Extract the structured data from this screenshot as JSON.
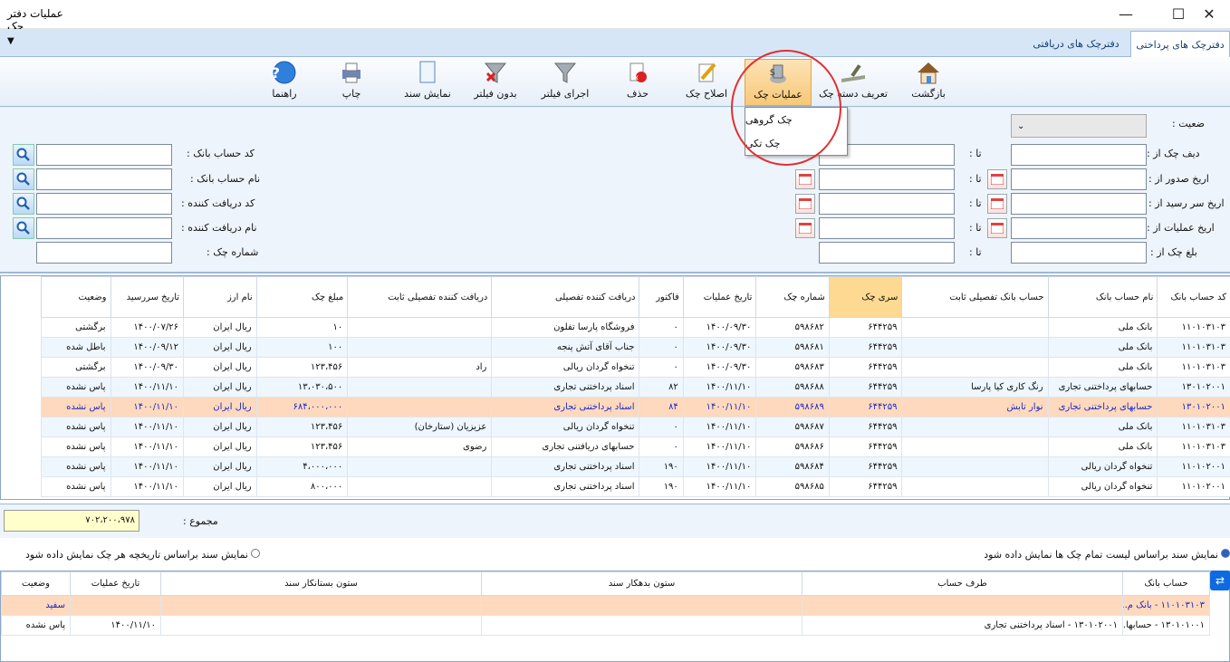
{
  "window": {
    "title": "عملیات دفتر چک",
    "minimize": "—",
    "maximize": "☐",
    "close": "✕"
  },
  "tabs": [
    {
      "label": "دفترچک های پرداختی"
    },
    {
      "label": "دفترچک های دریافتی"
    }
  ],
  "tab_menu_arrow": "▼",
  "toolbar": {
    "back": "بازگشت",
    "define_book": "تعریف دسته چک",
    "check_ops": "عملیات چک",
    "edit_check": "اصلاح چک",
    "delete": "حذف",
    "run_filter": "اجرای فیلتر",
    "no_filter": "بدون فیلتر",
    "show_doc": "نمایش سند",
    "print": "چاپ",
    "help": "راهنما"
  },
  "popup": {
    "group_check": "چک گروهی",
    "single_check": "چک تکی"
  },
  "filters": {
    "status": "ضعیت :",
    "check_row_from": "دیف چک از :",
    "issue_date_from": "اریخ صدور از :",
    "due_date_from": "اریخ سر رسید از :",
    "op_date_from": "اریخ عملیات از :",
    "amount_from": "بلغ چک از :",
    "to": "تا :",
    "bank_account_code": "کد حساب بانک :",
    "bank_account_name": "نام حساب بانک :",
    "receiver_code": "کد دریافت کننده :",
    "receiver_name": "نام دریافت کننده :",
    "check_number": "شماره چک :"
  },
  "grid": {
    "headers": [
      "کد حساب بانک",
      "نام حساب بانک",
      "حساب بانک تفصیلی ثابت",
      "سری چک",
      "شماره چک",
      "تاریخ عملیات",
      "فاکتور",
      "دریافت کننده تفصیلی",
      "دریافت کننده تفصیلی ثابت",
      "مبلغ چک",
      "نام ارز",
      "تاریخ سررسید",
      "وضعیت"
    ],
    "rows": [
      [
        "۱۱۰۱۰۳۱۰۳",
        "بانک ملی",
        "",
        "۶۴۴۲۵۹",
        "۵۹۸۶۸۲",
        "۱۴۰۰/۰۹/۳۰",
        "۰",
        "فروشگاه پارسا تفلون",
        "",
        "۱۰",
        "ریال ایران",
        "۱۴۰۰/۰۷/۲۶",
        "برگشتی"
      ],
      [
        "۱۱۰۱۰۳۱۰۳",
        "بانک ملی",
        "",
        "۶۴۴۲۵۹",
        "۵۹۸۶۸۱",
        "۱۴۰۰/۰۹/۳۰",
        "۰",
        "جناب آقای آتش پنجه",
        "",
        "۱۰۰",
        "ریال ایران",
        "۱۴۰۰/۰۹/۱۲",
        "باطل شده"
      ],
      [
        "۱۱۰۱۰۳۱۰۳",
        "بانک ملی",
        "",
        "۶۴۴۲۵۹",
        "۵۹۸۶۸۳",
        "۱۴۰۰/۰۹/۳۰",
        "۰",
        "تنخواه گردان ریالی",
        "راد",
        "۱۲۳،۴۵۶",
        "ریال ایران",
        "۱۴۰۰/۰۹/۳۰",
        "برگشتی"
      ],
      [
        "۱۳۰۱۰۲۰۰۱",
        "حسابهای پرداختنی تجاری",
        "رنگ کاری کیا پارسا",
        "۶۴۴۲۵۹",
        "۵۹۸۶۸۸",
        "۱۴۰۰/۱۱/۱۰",
        "۸۲",
        "اسناد پرداختنی تجاری",
        "",
        "۱۳،۰۳۰،۵۰۰",
        "ریال ایران",
        "۱۴۰۰/۱۱/۱۰",
        "پاس نشده"
      ],
      [
        "۱۳۰۱۰۲۰۰۱",
        "حسابهای پرداختنی تجاری",
        "نوار تابش",
        "۶۴۴۲۵۹",
        "۵۹۸۶۸۹",
        "۱۴۰۰/۱۱/۱۰",
        "۸۴",
        "اسناد پرداختنی تجاری",
        "",
        "۶۸۴،۰۰۰،۰۰۰",
        "ریال ایران",
        "۱۴۰۰/۱۱/۱۰",
        "پاس نشده"
      ],
      [
        "۱۱۰۱۰۳۱۰۳",
        "بانک ملی",
        "",
        "۶۴۴۲۵۹",
        "۵۹۸۶۸۷",
        "۱۴۰۰/۱۱/۱۰",
        "۰",
        "تنخواه گردان ریالی",
        "عزیزیان (ستارخان)",
        "۱۲۳،۴۵۶",
        "ریال ایران",
        "۱۴۰۰/۱۱/۱۰",
        "پاس نشده"
      ],
      [
        "۱۱۰۱۰۳۱۰۳",
        "بانک ملی",
        "",
        "۶۴۴۲۵۹",
        "۵۹۸۶۸۶",
        "۱۴۰۰/۱۱/۱۰",
        "۰",
        "حسابهای دریافتنی تجاری",
        "رضوی",
        "۱۲۳،۴۵۶",
        "ریال ایران",
        "۱۴۰۰/۱۱/۱۰",
        "پاس نشده"
      ],
      [
        "۱۱۰۱۰۲۰۰۱",
        "تنخواه گردان ریالی",
        "",
        "۶۴۴۲۵۹",
        "۵۹۸۶۸۴",
        "۱۴۰۰/۱۱/۱۰",
        "۱۹۰",
        "اسناد پرداختنی تجاری",
        "",
        "۴،۰۰۰،۰۰۰",
        "ریال ایران",
        "۱۴۰۰/۱۱/۱۰",
        "پاس نشده"
      ],
      [
        "۱۱۰۱۰۲۰۰۱",
        "تنخواه گردان ریالی",
        "",
        "۶۴۴۲۵۹",
        "۵۹۸۶۸۵",
        "۱۴۰۰/۱۱/۱۰",
        "۱۹۰",
        "اسناد پرداختنی تجاری",
        "",
        "۸۰۰،۰۰۰",
        "ریال ایران",
        "۱۴۰۰/۱۱/۱۰",
        "پاس نشده"
      ]
    ],
    "selected_row": 4
  },
  "sum": {
    "label": "مجموع :",
    "value": "۷۰۲،۲۰۰،۹۷۸"
  },
  "radios": {
    "all_checks": "نمایش سند براساس لیست تمام چک ها نمایش داده شود",
    "history": "نمایش سند براساس تاریخچه هر چک نمایش داده شود"
  },
  "history": {
    "headers": [
      "حساب بانک",
      "طرف حساب",
      "ستون بدهکار سند",
      "ستون بستانکار سند",
      "تاریخ عملیات",
      "وضعیت"
    ],
    "rows": [
      [
        "۱۱۰۱۰۳۱۰۳ - بانک م...",
        "",
        "",
        "",
        "",
        "سفید"
      ],
      [
        "۱۳۰۱۰۱۰۰۱ - حسابها...",
        "۱۳۰۱۰۲۰۰۱ - اسناد پرداختنی تجاری",
        "",
        "",
        "۱۴۰۰/۱۱/۱۰",
        "پاس نشده"
      ]
    ]
  },
  "colors": {
    "accent": "#e5a24a",
    "selected_row": "#ffd9bd",
    "selected_text": "#1a29c8",
    "highlight_header": "#fdd992",
    "tab_bar": "#d6e6f7"
  }
}
